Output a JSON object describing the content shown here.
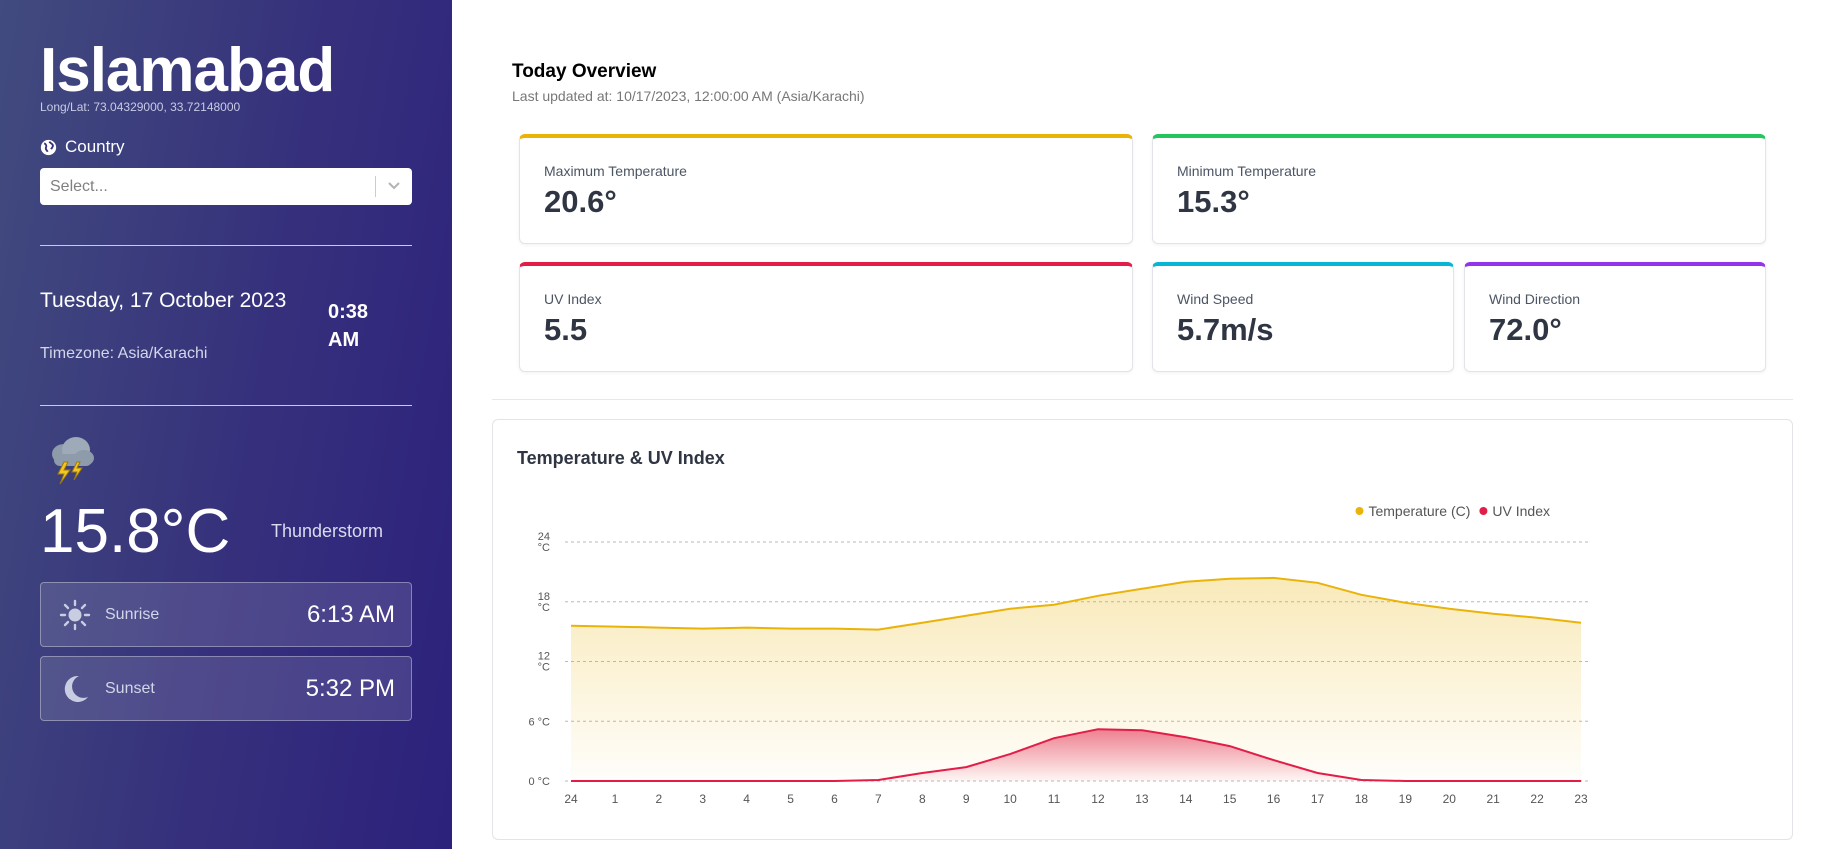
{
  "sidebar": {
    "city": "Islamabad",
    "coords": "Long/Lat: 73.04329000, 33.72148000",
    "country_label": "Country",
    "select_placeholder": "Select...",
    "date": "Tuesday, 17 October 2023",
    "timezone": "Timezone: Asia/Karachi",
    "time": "0:38 AM",
    "temperature": "15.8°C",
    "condition": "Thunderstorm",
    "sunrise": {
      "label": "Sunrise",
      "value": "6:13 AM"
    },
    "sunset": {
      "label": "Sunset",
      "value": "5:32 PM"
    }
  },
  "overview": {
    "title": "Today Overview",
    "updated": "Last updated at: 10/17/2023, 12:00:00 AM (Asia/Karachi)",
    "stats": {
      "max_temp": {
        "label": "Maximum Temperature",
        "value": "20.6°",
        "color": "#eab308"
      },
      "min_temp": {
        "label": "Minimum Temperature",
        "value": "15.3°",
        "color": "#22c55e"
      },
      "uv": {
        "label": "UV Index",
        "value": "5.5",
        "color": "#e11d48"
      },
      "wind_speed": {
        "label": "Wind Speed",
        "value": "5.7m/s",
        "color": "#06b6d4"
      },
      "wind_dir": {
        "label": "Wind Direction",
        "value": "72.0°",
        "color": "#9333ea"
      }
    }
  },
  "chart": {
    "title": "Temperature & UV Index"
  },
  "chart_data": {
    "type": "area",
    "x": [
      "24",
      "1",
      "2",
      "3",
      "4",
      "5",
      "6",
      "7",
      "8",
      "9",
      "10",
      "11",
      "12",
      "13",
      "14",
      "15",
      "16",
      "17",
      "18",
      "19",
      "20",
      "21",
      "22",
      "23"
    ],
    "y_ticks": [
      "0 °C",
      "6 °C",
      "12 °C",
      "18 °C",
      "24 °C"
    ],
    "ylim": [
      0,
      24
    ],
    "grid": true,
    "legend_position": "top-right",
    "series": [
      {
        "name": "Temperature (C)",
        "color": "#eab308",
        "values": [
          15.6,
          15.5,
          15.4,
          15.3,
          15.4,
          15.3,
          15.3,
          15.2,
          15.9,
          16.6,
          17.3,
          17.7,
          18.6,
          19.3,
          20.0,
          20.3,
          20.4,
          19.9,
          18.7,
          17.9,
          17.3,
          16.8,
          16.4,
          15.9
        ]
      },
      {
        "name": "UV Index",
        "color": "#e11d48",
        "values": [
          0,
          0,
          0,
          0,
          0,
          0,
          0,
          0.1,
          0.8,
          1.4,
          2.7,
          4.3,
          5.2,
          5.1,
          4.4,
          3.5,
          2.1,
          0.8,
          0.1,
          0,
          0,
          0,
          0,
          0
        ]
      }
    ]
  }
}
